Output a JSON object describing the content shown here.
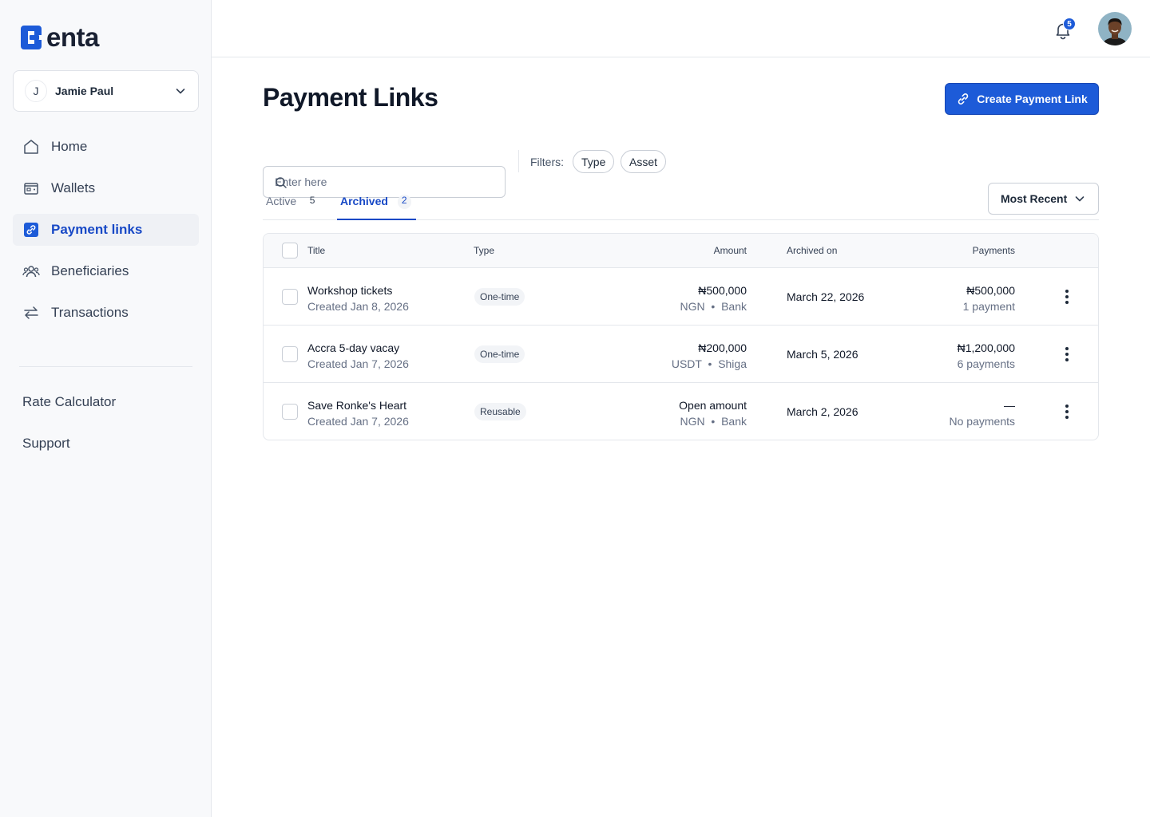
{
  "brand": {
    "name": "enta",
    "accent": "#1d5bd8"
  },
  "account": {
    "initial": "J",
    "name": "Jamie Paul"
  },
  "nav": [
    {
      "label": "Home",
      "icon": "home-icon"
    },
    {
      "label": "Wallets",
      "icon": "wallet-icon"
    },
    {
      "label": "Payment links",
      "icon": "link-icon",
      "active": true
    },
    {
      "label": "Beneficiaries",
      "icon": "users-icon"
    },
    {
      "label": "Transactions",
      "icon": "arrows-icon"
    }
  ],
  "secondary_nav": {
    "rate_calculator": "Rate Calculator",
    "support": "Support"
  },
  "topbar": {
    "notification_count": "5"
  },
  "page": {
    "title": "Payment Links",
    "create_button": "Create Payment Link"
  },
  "search": {
    "placeholder": "Enter here"
  },
  "filters": {
    "label": "Filters:",
    "chips": [
      "Type",
      "Asset"
    ]
  },
  "tabs": [
    {
      "label": "Active",
      "count": "5"
    },
    {
      "label": "Archived",
      "count": "2",
      "active": true
    }
  ],
  "sort": {
    "label": "Most Recent"
  },
  "table": {
    "headers": {
      "title": "Title",
      "type": "Type",
      "amount": "Amount",
      "archived_on": "Archived on",
      "payments": "Payments"
    },
    "rows": [
      {
        "title": "Workshop tickets",
        "created": "Created Jan 8, 2026",
        "type": "One-time",
        "amount": "₦500,000",
        "currency": "NGN",
        "method": "Bank",
        "archived_on": "March 22, 2026",
        "payments_total": "₦500,000",
        "payments_count": "1 payment"
      },
      {
        "title": "Accra 5-day vacay",
        "created": "Created Jan 7, 2026",
        "type": "One-time",
        "amount": "₦200,000",
        "currency": "USDT",
        "method": "Shiga",
        "archived_on": "March 5, 2026",
        "payments_total": "₦1,200,000",
        "payments_count": "6 payments"
      },
      {
        "title": "Save Ronke's Heart",
        "created": "Created Jan 7, 2026",
        "type": "Reusable",
        "amount": "Open amount",
        "currency": "NGN",
        "method": "Bank",
        "archived_on": "March 2, 2026",
        "payments_total": "—",
        "payments_count": "No payments"
      }
    ]
  }
}
